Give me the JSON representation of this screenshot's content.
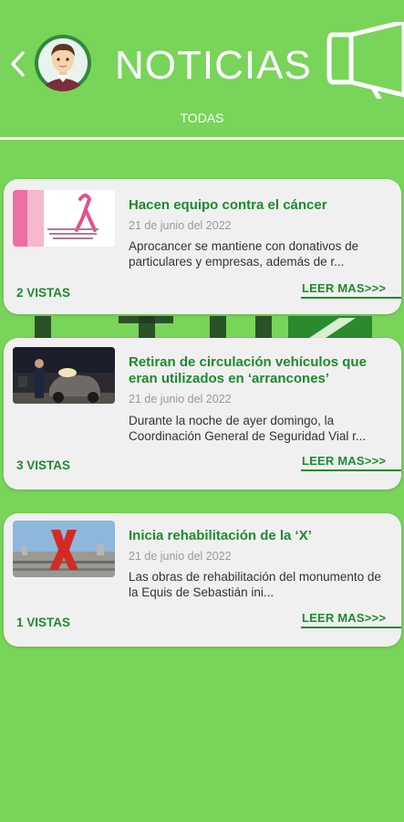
{
  "header": {
    "title": "NOTICIAS",
    "tab_label": "TODAS"
  },
  "colors": {
    "background": "#79d45a",
    "accent": "#1f8a2e",
    "card": "#f0f0f0"
  },
  "news": [
    {
      "title": "Hacen equipo contra el cáncer",
      "date": "21 de junio del 2022",
      "excerpt": "Aprocancer se mantiene con donativos de particulares y empresas, además de r...",
      "views": "2 VISTAS",
      "read_more": "LEER MAS>>>"
    },
    {
      "title": "Retiran de circulación vehículos que eran utilizados en ‘arrancones’",
      "date": "21 de junio del 2022",
      "excerpt": "Durante la noche de ayer domingo, la Coordinación General de Seguridad Vial r...",
      "views": "3 VISTAS",
      "read_more": "LEER MAS>>>"
    },
    {
      "title": "Inicia rehabilitación de la ‘X’",
      "date": "21 de junio del 2022",
      "excerpt": "Las obras de rehabilitación del monumento de la Equis de Sebastián ini...",
      "views": "1 VISTAS",
      "read_more": "LEER MAS>>>"
    }
  ]
}
